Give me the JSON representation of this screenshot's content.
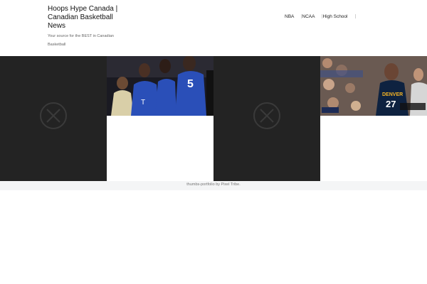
{
  "site": {
    "title": "Hoops Hype Canada | Canadian Basketball News",
    "description": "Your source for the BEST in Canadian Basketball"
  },
  "nav": {
    "items": [
      {
        "label": "NBA"
      },
      {
        "label": "NCAA"
      },
      {
        "label": "High School"
      }
    ]
  },
  "grid": {
    "tiles": [
      {
        "type": "placeholder"
      },
      {
        "type": "photo",
        "subject": "college basketball players in blue jerseys",
        "jersey_text": "5"
      },
      {
        "type": "placeholder"
      },
      {
        "type": "photo",
        "subject": "Denver player in navy jersey",
        "jersey_text": "DENVER 27"
      }
    ]
  },
  "footer": {
    "credit": "thumbs-portfolio by Pixel Tribe."
  },
  "colors": {
    "tile_dark": "#232323",
    "denver_navy": "#0e2240",
    "kentucky_blue": "#2a4fb8",
    "footer_bg": "#f4f5f6"
  }
}
